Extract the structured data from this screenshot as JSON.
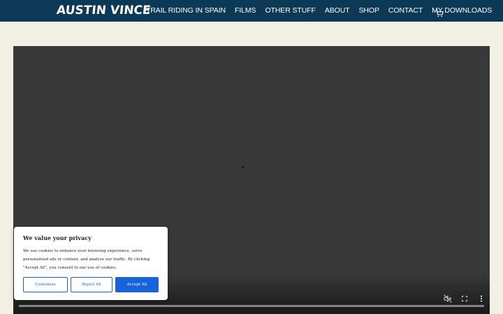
{
  "header": {
    "logo_text": "AUSTIN VINCE",
    "nav_items": [
      {
        "label": "TRAIL RIDING IN SPAIN"
      },
      {
        "label": "FILMS"
      },
      {
        "label": "OTHER STUFF"
      },
      {
        "label": "ABOUT"
      },
      {
        "label": "SHOP"
      },
      {
        "label": "CONTACT"
      },
      {
        "label": "MY DOWNLOADS"
      }
    ],
    "cart_icon": "shopping-cart-icon"
  },
  "video": {
    "controls": [
      "mute-icon",
      "fullscreen-icon",
      "more-options-icon"
    ]
  },
  "consent": {
    "title": "We value your privacy",
    "text": "We use cookies to enhance your browsing experience, serve personalised ads or content, and analyse our traffic. By clicking \"Accept All\", you consent to our use of cookies.",
    "customise_label": "Customise",
    "reject_label": "Reject All",
    "accept_label": "Accept All"
  },
  "colors": {
    "header_bg": "#0c3a56",
    "page_bg": "#f2efe3",
    "video_bg": "#393939",
    "accent": "#1863dc"
  }
}
